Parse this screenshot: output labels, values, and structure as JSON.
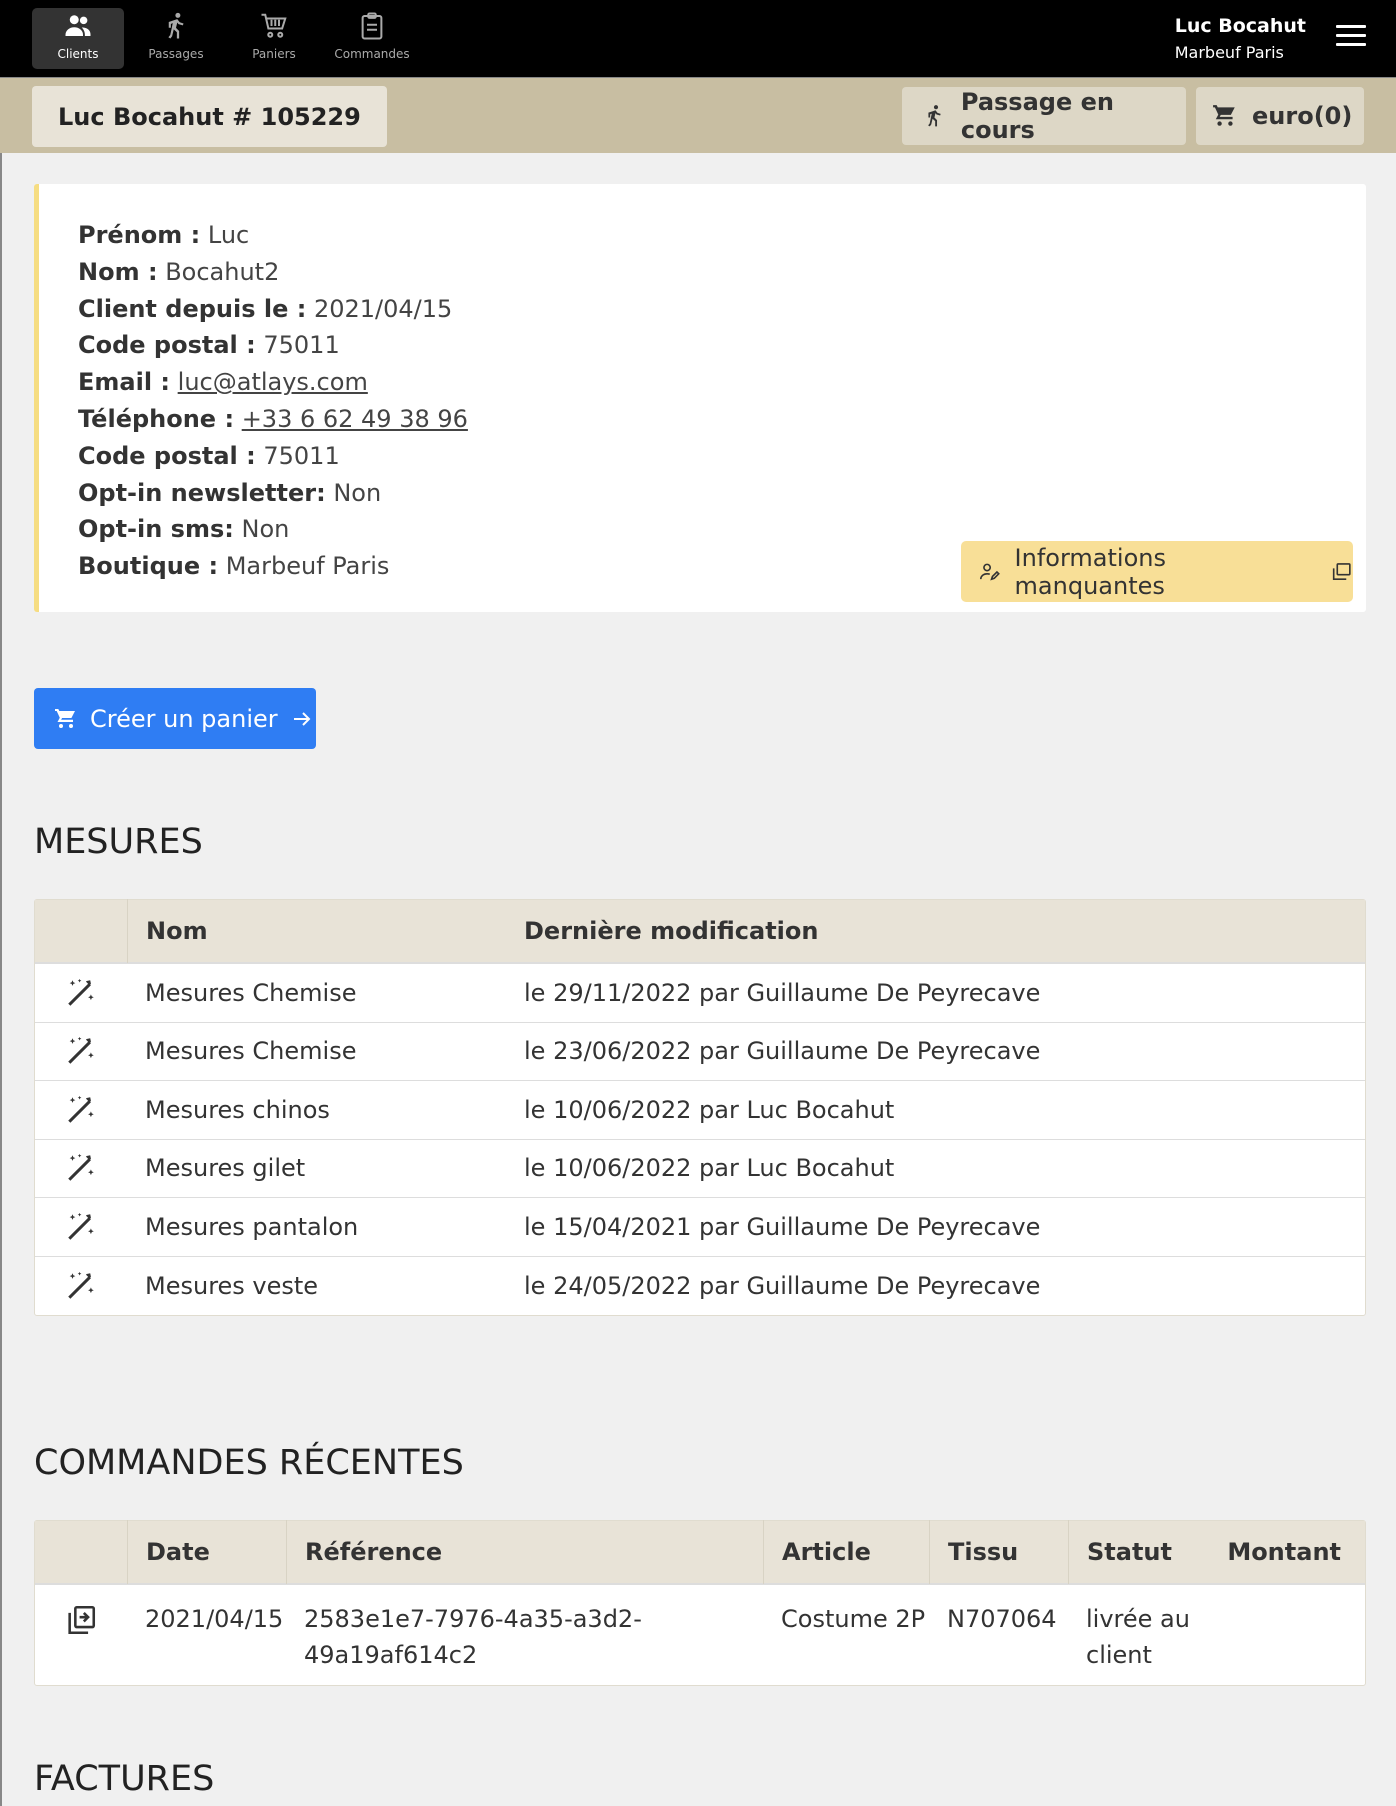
{
  "nav": {
    "items": [
      {
        "label": "Clients",
        "icon": "people-icon"
      },
      {
        "label": "Passages",
        "icon": "walking-icon"
      },
      {
        "label": "Paniers",
        "icon": "cart-icon"
      },
      {
        "label": "Commandes",
        "icon": "clipboard-icon"
      }
    ],
    "user_name": "Luc Bocahut",
    "user_shop": "Marbeuf Paris"
  },
  "subheader": {
    "client_title": "Luc Bocahut # 105229",
    "passage_label": "Passage en cours",
    "cart_label": "euro(0)"
  },
  "client": {
    "fields": [
      {
        "label": "Prénom :",
        "value": "Luc"
      },
      {
        "label": "Nom :",
        "value": "Bocahut2"
      },
      {
        "label": "Client depuis le :",
        "value": "2021/04/15"
      },
      {
        "label": "Code postal :",
        "value": "75011"
      },
      {
        "label": "Email :",
        "value": "luc@atlays.com"
      },
      {
        "label": "Téléphone :",
        "value": "+33 6 62 49 38 96"
      },
      {
        "label": "Code postal :",
        "value": "75011"
      },
      {
        "label": "Opt-in newsletter:",
        "value": "Non"
      },
      {
        "label": "Opt-in sms:",
        "value": "Non"
      },
      {
        "label": "Boutique :",
        "value": "Marbeuf Paris"
      }
    ],
    "missing_info_label": "Informations manquantes"
  },
  "create_cart_label": "Créer un panier",
  "mesures": {
    "title": "MESURES",
    "headers": {
      "name": "Nom",
      "modified": "Dernière modification"
    },
    "rows": [
      {
        "name": "Mesures Chemise",
        "modified": "le 29/11/2022 par Guillaume De Peyrecave"
      },
      {
        "name": "Mesures Chemise",
        "modified": "le 23/06/2022 par Guillaume De Peyrecave"
      },
      {
        "name": "Mesures chinos",
        "modified": "le 10/06/2022 par Luc Bocahut"
      },
      {
        "name": "Mesures gilet",
        "modified": "le 10/06/2022 par Luc Bocahut"
      },
      {
        "name": "Mesures pantalon",
        "modified": "le 15/04/2021 par Guillaume De Peyrecave"
      },
      {
        "name": "Mesures veste",
        "modified": "le 24/05/2022 par Guillaume De Peyrecave"
      }
    ]
  },
  "commandes": {
    "title": "COMMANDES RÉCENTES",
    "headers": {
      "date": "Date",
      "ref": "Référence",
      "article": "Article",
      "tissu": "Tissu",
      "statut": "Statut",
      "montant": "Montant"
    },
    "rows": [
      {
        "date": "2021/04/15",
        "ref": "2583e1e7-7976-4a35-a3d2-49a19af614c2",
        "article": "Costume 2P",
        "tissu": "N707064",
        "statut": "livrée au client",
        "montant": ""
      }
    ]
  },
  "factures": {
    "title": "FACTURES"
  }
}
